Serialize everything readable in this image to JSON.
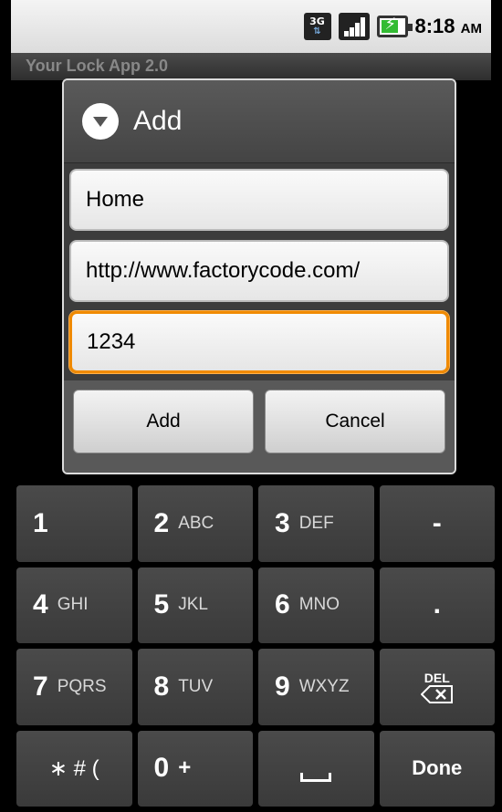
{
  "status_bar": {
    "network": "3G",
    "time": "8:18",
    "ampm": "AM"
  },
  "app": {
    "title": "Your Lock App 2.0"
  },
  "dialog": {
    "title": "Add",
    "fields": [
      {
        "value": "Home"
      },
      {
        "value": "http://www.factorycode.com/"
      },
      {
        "value": "1234"
      }
    ],
    "buttons": {
      "add": "Add",
      "cancel": "Cancel"
    }
  },
  "keypad": {
    "rows": [
      [
        {
          "num": "1",
          "letters": ""
        },
        {
          "num": "2",
          "letters": "ABC"
        },
        {
          "num": "3",
          "letters": "DEF"
        },
        {
          "sym": "-"
        }
      ],
      [
        {
          "num": "4",
          "letters": "GHI"
        },
        {
          "num": "5",
          "letters": "JKL"
        },
        {
          "num": "6",
          "letters": "MNO"
        },
        {
          "sym": "."
        }
      ],
      [
        {
          "num": "7",
          "letters": "PQRS"
        },
        {
          "num": "8",
          "letters": "TUV"
        },
        {
          "num": "9",
          "letters": "WXYZ"
        },
        {
          "del": "DEL"
        }
      ],
      [
        {
          "sym": "∗ # ("
        },
        {
          "num": "0",
          "letters": "+"
        },
        {
          "space": ""
        },
        {
          "done": "Done"
        }
      ]
    ]
  }
}
